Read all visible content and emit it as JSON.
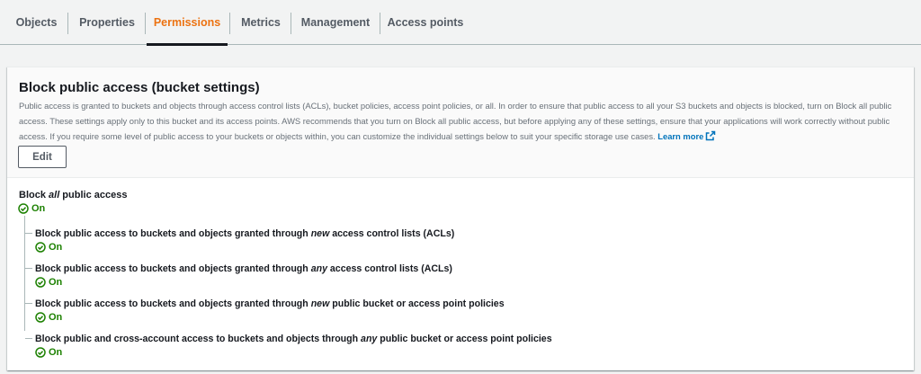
{
  "tabs": [
    {
      "label": "Objects",
      "active": false
    },
    {
      "label": "Properties",
      "active": false
    },
    {
      "label": "Permissions",
      "active": true
    },
    {
      "label": "Metrics",
      "active": false
    },
    {
      "label": "Management",
      "active": false
    },
    {
      "label": "Access points",
      "active": false
    }
  ],
  "panel": {
    "title": "Block public access (bucket settings)",
    "description": "Public access is granted to buckets and objects through access control lists (ACLs), bucket policies, access point policies, or all. In order to ensure that public access to all your S3 buckets and objects is blocked, turn on Block all public access. These settings apply only to this bucket and its access points. AWS recommends that you turn on Block all public access, but before applying any of these settings, ensure that your applications will work correctly without public access. If you require some level of public access to your buckets or objects within, you can customize the individual settings below to suit your specific storage use cases.",
    "learn_more": "Learn more",
    "edit_label": "Edit"
  },
  "block_all": {
    "label_pre": "Block ",
    "label_em": "all",
    "label_post": " public access",
    "status": "On"
  },
  "settings": [
    {
      "pre": "Block public access to buckets and objects granted through ",
      "em": "new",
      "post": " access control lists (ACLs)",
      "status": "On"
    },
    {
      "pre": "Block public access to buckets and objects granted through ",
      "em": "any",
      "post": " access control lists (ACLs)",
      "status": "On"
    },
    {
      "pre": "Block public access to buckets and objects granted through ",
      "em": "new",
      "post": " public bucket or access point policies",
      "status": "On"
    },
    {
      "pre": "Block public and cross-account access to buckets and objects through ",
      "em": "any",
      "post": " public bucket or access point policies",
      "status": "On"
    }
  ],
  "colors": {
    "accent": "#ec7211",
    "link": "#0073bb",
    "success": "#1d8102"
  },
  "icons": {
    "status": "check-circle-icon",
    "external": "external-link-icon"
  }
}
